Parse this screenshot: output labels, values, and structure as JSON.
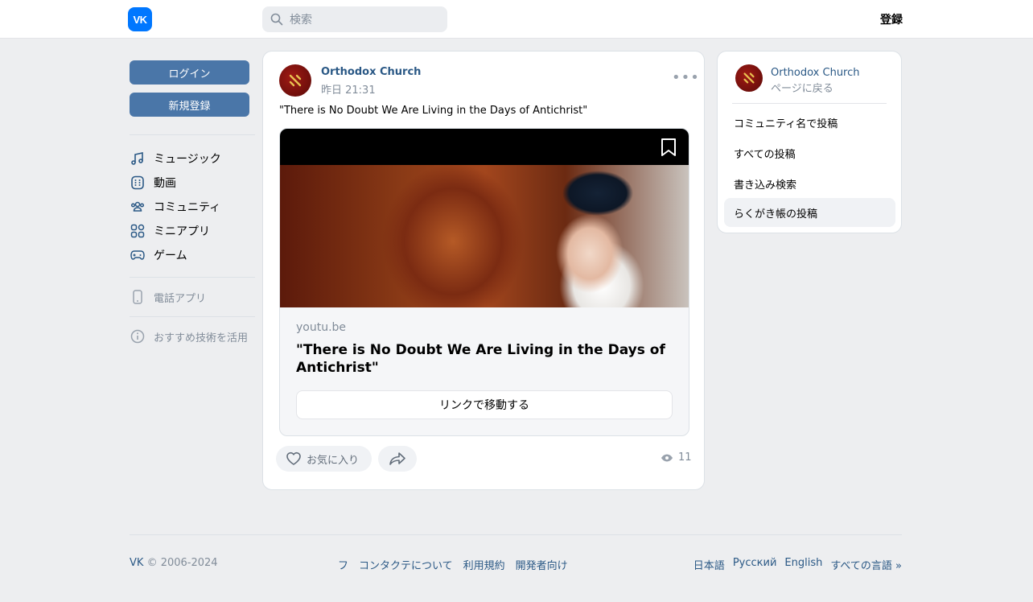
{
  "header": {
    "logo_text": "VK",
    "search_placeholder": "検索",
    "register_label": "登録"
  },
  "sidebar": {
    "login_label": "ログイン",
    "signup_label": "新規登録",
    "items": [
      {
        "label": "ミュージック",
        "icon": "music-icon"
      },
      {
        "label": "動画",
        "icon": "video-icon"
      },
      {
        "label": "コミュニティ",
        "icon": "community-icon"
      },
      {
        "label": "ミニアプリ",
        "icon": "mini-apps-icon"
      },
      {
        "label": "ゲーム",
        "icon": "gamepad-icon"
      }
    ],
    "phone_app_label": "電話アプリ",
    "tech_label": "おすすめ技術を活用"
  },
  "post": {
    "author": "Orthodox Church",
    "time": "昨日 21:31",
    "text": "\"There is No Doubt We Are Living in the Days of Antichrist\"",
    "snippet": {
      "domain": "youtu.be",
      "title": "\"There is No Doubt We Are Living in the Days of Antichrist\"",
      "button_label": "リンクで移動する"
    },
    "like_label": "お気に入り",
    "views": "11"
  },
  "side_card": {
    "author": "Orthodox Church",
    "back_label": "ページに戻る",
    "items": [
      {
        "label": "コミュニティ名で投稿"
      },
      {
        "label": "すべての投稿"
      },
      {
        "label": "書き込み検索"
      },
      {
        "label": "らくがき帳の投稿"
      }
    ]
  },
  "footer": {
    "brand": "VK",
    "copyright": "© 2006-2024",
    "links": [
      "フ",
      "コンタクテについて",
      "利用規約",
      "開発者向け"
    ],
    "languages": [
      "日本語",
      "Русский",
      "English",
      "すべての言語 »"
    ]
  },
  "colors": {
    "accent": "#4a76a8",
    "link": "#2a5885",
    "muted": "#818c99",
    "background": "#edeef0"
  }
}
